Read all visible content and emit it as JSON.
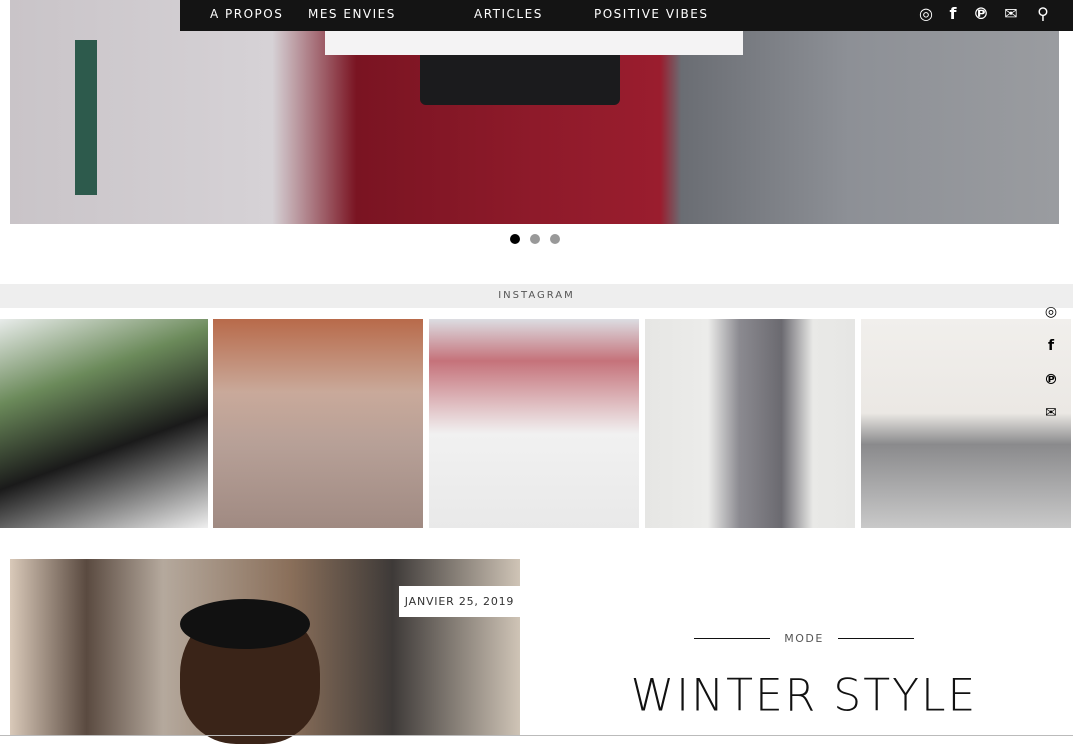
{
  "nav": {
    "links": [
      "A PROPOS",
      "MES ENVIES",
      "ARTICLES",
      "POSITIVE VIBES"
    ],
    "icons": [
      "instagram-icon",
      "facebook-icon",
      "pinterest-icon",
      "email-icon",
      "search-icon"
    ]
  },
  "slider": {
    "slides": 3,
    "active": 1
  },
  "instagram": {
    "title": "INSTAGRAM",
    "photo_count": 5
  },
  "side_social": [
    "instagram-icon",
    "facebook-icon",
    "pinterest-icon",
    "email-icon"
  ],
  "post": {
    "date": "JANVIER 25, 2019",
    "category": "MODE",
    "title": "WINTER STYLE"
  }
}
